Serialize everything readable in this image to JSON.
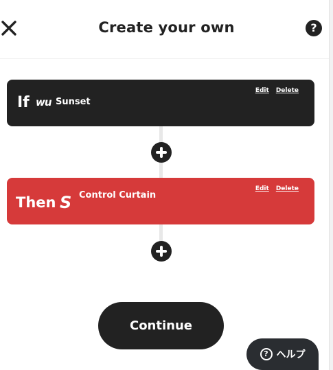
{
  "header": {
    "title": "Create your own",
    "help_icon_glyph": "?"
  },
  "trigger": {
    "keyword": "If",
    "service_logo_text": "wu",
    "service": "Sunset",
    "edit_label": "Edit",
    "delete_label": "Delete",
    "color": "#222222"
  },
  "action": {
    "keyword": "Then",
    "service_logo_text": "S",
    "service": "Control Curtain",
    "edit_label": "Edit",
    "delete_label": "Delete",
    "color": "#d63a3a"
  },
  "continue_label": "Continue",
  "help_chat": {
    "icon_glyph": "?",
    "label": "ヘルプ"
  },
  "icons": [
    "close-icon",
    "help-icon",
    "plus-icon",
    "question-circle-icon"
  ]
}
